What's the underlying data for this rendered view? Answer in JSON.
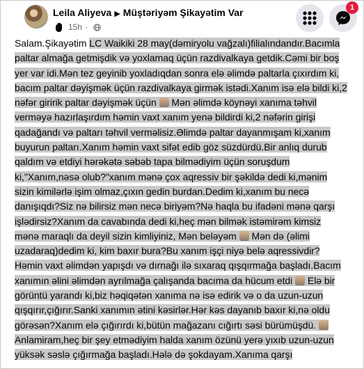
{
  "post": {
    "author": "Leila Aliyeva",
    "group": "Müştəriyəm Şikayətim Var",
    "time": "15h",
    "greeting": "Salam.Şikayətim ",
    "body_1": "LC Waikiki  28 may(dəmiryolu vağzalı)filialındandır.Bacımla paltar almağa getmişdik və yoxlamaq üçün razdivalkaya getdik.Cəmi bir boş yer var idi.Mən tez geyinib yoxladıqdan sonra elə əlimdə paltarla çıxırdım ki, bacım paltar dəyişmək üçün razdivalkaya girmək istədi.Xanım isə elə bildi ki,2 nəfər giririk paltar dəyişmək üçün ",
    "body_2": "Mən əlimdə köynəyi xanıma təhvil verməyə hazırlaşırdım həmin vaxt xanım yenə bildirdi ki,2 nəfərin girişi qadağandı və paltarı təhvil verməlisiz.Əlimdə paltar dayanmışam ki,xanım buyurun paltarı.Xanım həmin vaxt sifət edib göz süzdürdü.Bir anlıq durub qaldım və etdiyi hərəkətə səbəb tapa bilmədiyim üçün soruşdum ki,\"Xanım,nəsə olub?\"xanım mənə çox aqressiv bir şəkildə dedi ki,mənim sizin kimilərlə işim olmaz,çıxın gedin burdan.Dedim ki,xanım bu necə danışıqdı?Siz nə bilirsiz mən necə biriyəm?Nə haqla bu ifadəni mənə qarşı işlədirsiz?Xanım da cavabında dedi ki,heç mən bilmək istəmirəm kimsiz mənə maraqlı da deyil sizin kimliyiniz, Mən beləyəm ",
    "body_3": "Mən də (əlimi uzadaraq)dedim ki, kim baxır bura?Bu xanım işçi niyə belə aqressivdir?Həmin vaxt əlimdən yapışdı və dırnağı ilə sıxaraq qışqırmağa  başladı.Bacım xanımın əlini əlimdən ayrılmağa çalışanda bacıma da hücum etdi ",
    "body_4": "Elə bir görüntü yarandı ki,biz həqiqətən xanıma nə isə edirik və o da uzun-uzun qışqırır,çığırır.Sanki xanımın ətini kəsirlər.Hər kəs dayanıb baxır ki,nə oldu görəsən?Xanım elə çığırırdı ki,bütün mağazanı cığırtı səsi bürümüşdü. ",
    "body_5": "Anlamiram,heç bir şey etmədiyim halda xanım özünü yerə yıxıb uzun-uzun yüksək səslə çığırmağa başladı.Hələ də şokdayam.Xanıma qarşı"
  },
  "header": {
    "notification_count": "1"
  },
  "icons": {
    "avatar": "profile-photo",
    "arrow": "right-triangle-icon",
    "member_badge": "waving-hand-icon",
    "privacy": "globe-icon",
    "menu": "grid-menu-icon",
    "messenger": "messenger-icon",
    "emoji": "face-emoji-icon"
  },
  "colors": {
    "highlight": "#c8c8c8",
    "badge": "#e41e3f",
    "secondary_text": "#65676b"
  }
}
